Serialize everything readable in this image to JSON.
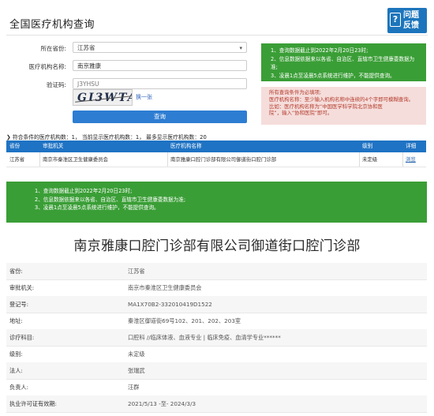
{
  "header": {
    "title": "全国医疗机构查询",
    "help_line1": "问题",
    "help_line2": "反馈",
    "help_glyph": "?"
  },
  "form": {
    "province_label": "所在省份:",
    "province_value": "江苏省",
    "name_label": "医疗机构名称:",
    "name_value": "南京雅康",
    "code_label": "验证码:",
    "code_value": "J3YHSU",
    "captcha_text": "GI3WTA",
    "refresh_label": "换一张",
    "submit_label": "查询"
  },
  "notice_top": {
    "lines": [
      "1、查询数据截止到2022年2月20日23时;",
      "2、信息数据依据来以各省、自治区、直辖市卫生健康委数据为准;",
      "3、凌晨1点至凌晨5点系统进行维护，不能提供查询。"
    ]
  },
  "tip": {
    "l1": "所有查询条件为必填项;",
    "l2": "医疗机构名称：至少输入机构名称中连续的4个字即可模糊查询。",
    "l3": "比如：医疗机构名称为“中国医学科学院北京协和医",
    "l4": "院”，输入“协和医院”即可。"
  },
  "results": {
    "count_text": "符合条件的医疗机构数：1， 当前显示医疗机构数：1， 最多显示医疗机构数：20",
    "columns": [
      "省份",
      "审批机关",
      "医疗机构名称",
      "级别",
      "详细"
    ],
    "rows": [
      [
        "江苏省",
        "南京市秦淮区卫生健康委员会",
        "南京雅康口腔门诊部有限公司御道街口腔门诊部",
        "未定级",
        "浏览"
      ]
    ]
  },
  "notice_bottom": {
    "lines": [
      "1、查询数据截止到2022年2月20日23时;",
      "2、信息数据依据来以各省、自治区、直辖市卫生健康委数据为准;",
      "3、凌晨1点至凌晨5点系统进行维护，不能提供查询。"
    ]
  },
  "detail": {
    "title": "南京雅康口腔门诊部有限公司御道街口腔门诊部",
    "fields": [
      {
        "k": "省份:",
        "v": "江苏省"
      },
      {
        "k": "审批机关:",
        "v": "南京市秦淮区卫生健康委员会"
      },
      {
        "k": "登记号:",
        "v": "MA1X70B2-332010419D1522"
      },
      {
        "k": "地址:",
        "v": "秦淮区御道街69号102、201、202、203室"
      },
      {
        "k": "诊疗科目:",
        "v": "口腔科 //临床体液、血液专业 | 临床免疫、血清学专业******"
      },
      {
        "k": "级别:",
        "v": "未定级"
      },
      {
        "k": "法人:",
        "v": "张瑞武"
      },
      {
        "k": "负责人:",
        "v": "汪群"
      },
      {
        "k": "执业许可证有效期:",
        "v": "2021/5/13 -至- 2024/3/3"
      }
    ]
  }
}
